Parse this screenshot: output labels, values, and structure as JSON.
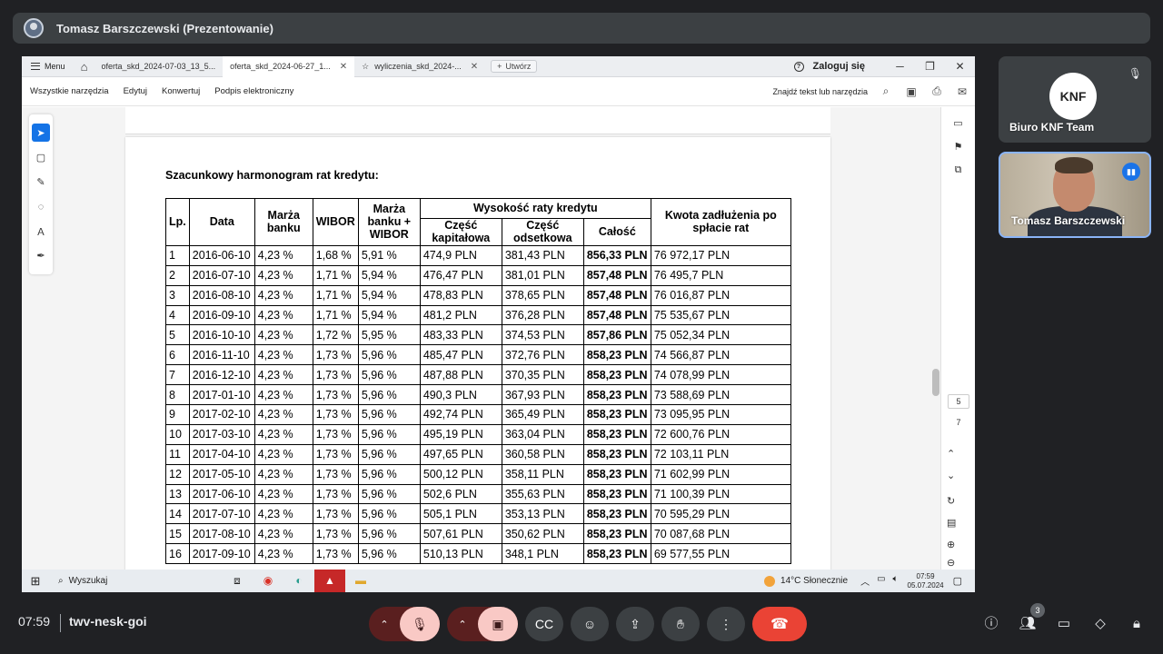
{
  "presenter": {
    "name": "Tomasz Barszczewski (Prezentowanie)"
  },
  "browser": {
    "menu_label": "Menu",
    "tabs": [
      {
        "label": "oferta_skd_2024-07-03_13_5...",
        "active": false
      },
      {
        "label": "oferta_skd_2024-06-27_1...",
        "active": true
      },
      {
        "label": "wyliczenia_skd_2024-...",
        "active": false
      }
    ],
    "new_tab_label": "Utwórz",
    "login_label": "Zaloguj się"
  },
  "toolbar": {
    "items": [
      "Wszystkie narzędzia",
      "Edytuj",
      "Konwertuj",
      "Podpis elektroniczny"
    ],
    "find_label": "Znajdź tekst lub narzędzia"
  },
  "document": {
    "heading": "Szacunkowy harmonogram rat kredytu:",
    "headers": {
      "lp": "Lp.",
      "date": "Data",
      "margin": "Marża banku",
      "wibor": "WIBOR",
      "margin_wibor": "Marża banku + WIBOR",
      "installment": "Wysokość raty kredytu",
      "capital": "Część kapitałowa",
      "interest": "Część odsetkowa",
      "total": "Całość",
      "debt": "Kwota zadłużenia po spłacie rat"
    },
    "rows": [
      [
        "1",
        "2016-06-10",
        "4,23 %",
        "1,68 %",
        "5,91 %",
        "474,9 PLN",
        "381,43 PLN",
        "856,33 PLN",
        "76 972,17 PLN"
      ],
      [
        "2",
        "2016-07-10",
        "4,23 %",
        "1,71 %",
        "5,94 %",
        "476,47 PLN",
        "381,01 PLN",
        "857,48 PLN",
        "76 495,7 PLN"
      ],
      [
        "3",
        "2016-08-10",
        "4,23 %",
        "1,71 %",
        "5,94 %",
        "478,83 PLN",
        "378,65 PLN",
        "857,48 PLN",
        "76 016,87 PLN"
      ],
      [
        "4",
        "2016-09-10",
        "4,23 %",
        "1,71 %",
        "5,94 %",
        "481,2 PLN",
        "376,28 PLN",
        "857,48 PLN",
        "75 535,67 PLN"
      ],
      [
        "5",
        "2016-10-10",
        "4,23 %",
        "1,72 %",
        "5,95 %",
        "483,33 PLN",
        "374,53 PLN",
        "857,86 PLN",
        "75 052,34 PLN"
      ],
      [
        "6",
        "2016-11-10",
        "4,23 %",
        "1,73 %",
        "5,96 %",
        "485,47 PLN",
        "372,76 PLN",
        "858,23 PLN",
        "74 566,87 PLN"
      ],
      [
        "7",
        "2016-12-10",
        "4,23 %",
        "1,73 %",
        "5,96 %",
        "487,88 PLN",
        "370,35 PLN",
        "858,23 PLN",
        "74 078,99 PLN"
      ],
      [
        "8",
        "2017-01-10",
        "4,23 %",
        "1,73 %",
        "5,96 %",
        "490,3 PLN",
        "367,93 PLN",
        "858,23 PLN",
        "73 588,69 PLN"
      ],
      [
        "9",
        "2017-02-10",
        "4,23 %",
        "1,73 %",
        "5,96 %",
        "492,74 PLN",
        "365,49 PLN",
        "858,23 PLN",
        "73 095,95 PLN"
      ],
      [
        "10",
        "2017-03-10",
        "4,23 %",
        "1,73 %",
        "5,96 %",
        "495,19 PLN",
        "363,04 PLN",
        "858,23 PLN",
        "72 600,76 PLN"
      ],
      [
        "11",
        "2017-04-10",
        "4,23 %",
        "1,73 %",
        "5,96 %",
        "497,65 PLN",
        "360,58 PLN",
        "858,23 PLN",
        "72 103,11 PLN"
      ],
      [
        "12",
        "2017-05-10",
        "4,23 %",
        "1,73 %",
        "5,96 %",
        "500,12 PLN",
        "358,11 PLN",
        "858,23 PLN",
        "71 602,99 PLN"
      ],
      [
        "13",
        "2017-06-10",
        "4,23 %",
        "1,73 %",
        "5,96 %",
        "502,6 PLN",
        "355,63 PLN",
        "858,23 PLN",
        "71 100,39 PLN"
      ],
      [
        "14",
        "2017-07-10",
        "4,23 %",
        "1,73 %",
        "5,96 %",
        "505,1 PLN",
        "353,13 PLN",
        "858,23 PLN",
        "70 595,29 PLN"
      ],
      [
        "15",
        "2017-08-10",
        "4,23 %",
        "1,73 %",
        "5,96 %",
        "507,61 PLN",
        "350,62 PLN",
        "858,23 PLN",
        "70 087,68 PLN"
      ],
      [
        "16",
        "2017-09-10",
        "4,23 %",
        "1,73 %",
        "5,96 %",
        "510,13 PLN",
        "348,1 PLN",
        "858,23 PLN",
        "69 577,55 PLN"
      ]
    ]
  },
  "page_indicator": {
    "current": "5",
    "total": "7"
  },
  "taskbar": {
    "search_label": "Wyszukaj",
    "weather": "14°C Słonecznie",
    "time": "07:59",
    "date": "05.07.2024"
  },
  "participants": [
    {
      "name": "Biuro KNF Team",
      "logo_text": "KNF"
    },
    {
      "name": "Tomasz Barszczewski"
    }
  ],
  "meeting": {
    "clock": "07:59",
    "code": "twv-nesk-goi",
    "people_count": "3"
  },
  "colors": {
    "meet_bg": "#202124",
    "end_call": "#ea4335",
    "acrobat_select": "#1473e6",
    "speaking_border": "#8ab4f8"
  }
}
